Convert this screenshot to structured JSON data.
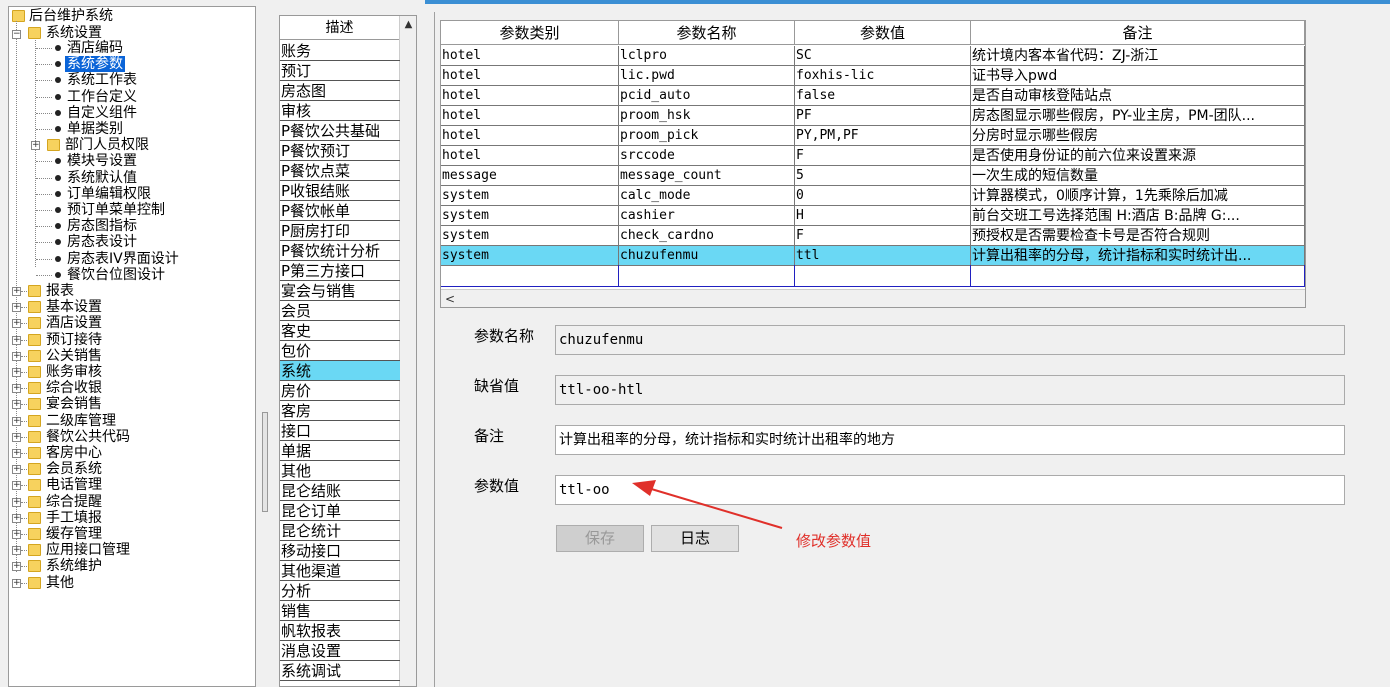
{
  "tree": {
    "root": "后台维护系统",
    "system_settings": "系统设置",
    "children": [
      "酒店编码",
      "系统参数",
      "系统工作表",
      "工作台定义",
      "自定义组件",
      "单据类别",
      "部门人员权限",
      "模块号设置",
      "系统默认值",
      "订单编辑权限",
      "预订单菜单控制",
      "房态图指标",
      "房态表设计",
      "房态表IV界面设计",
      "餐饮台位图设计"
    ],
    "selected": "系统参数",
    "groups": [
      "报表",
      "基本设置",
      "酒店设置",
      "预订接待",
      "公关销售",
      "账务审核",
      "综合收银",
      "宴会销售",
      "二级库管理",
      "餐饮公共代码",
      "客房中心",
      "会员系统",
      "电话管理",
      "综合提醒",
      "手工填报",
      "缓存管理",
      "应用接口管理",
      "系统维护",
      "其他"
    ]
  },
  "categories": {
    "header": "描述",
    "items": [
      "账务",
      "预订",
      "房态图",
      "审核",
      "P餐饮公共基础",
      "P餐饮预订",
      "P餐饮点菜",
      "P收银结账",
      "P餐饮帐单",
      "P厨房打印",
      "P餐饮统计分析",
      "P第三方接口",
      "宴会与销售",
      "会员",
      "客史",
      "包价",
      "系统",
      "房价",
      "客房",
      "接口",
      "单据",
      "其他",
      "昆仑结账",
      "昆仑订单",
      "昆仑统计",
      "移动接口",
      "其他渠道",
      "分析",
      "销售",
      "帆软报表",
      "消息设置",
      "系统调试"
    ],
    "selected": "系统"
  },
  "grid": {
    "columns": [
      "参数类别",
      "参数名称",
      "参数值",
      "备注"
    ],
    "rows": [
      [
        "hotel",
        "lclpro",
        "SC",
        "统计境内客本省代码：ZJ-浙江"
      ],
      [
        "hotel",
        "lic.pwd",
        "foxhis-lic",
        "证书导入pwd"
      ],
      [
        "hotel",
        "pcid_auto",
        "false",
        "是否自动审核登陆站点"
      ],
      [
        "hotel",
        "proom_hsk",
        "PF",
        "房态图显示哪些假房，PY-业主房，PM-团队..."
      ],
      [
        "hotel",
        "proom_pick",
        "PY,PM,PF",
        "分房时显示哪些假房"
      ],
      [
        "hotel",
        "srccode",
        "F",
        "是否使用身份证的前六位来设置来源"
      ],
      [
        "message",
        "message_count",
        "5",
        "一次生成的短信数量"
      ],
      [
        "system",
        "calc_mode",
        "0",
        "计算器模式，0顺序计算，1先乘除后加减"
      ],
      [
        "system",
        "cashier",
        "H",
        "前台交班工号选择范围 H:酒店  B:品牌 G:..."
      ],
      [
        "system",
        "check_cardno",
        "F",
        "预授权是否需要检查卡号是否符合规则"
      ],
      [
        "system",
        "chuzufenmu",
        "ttl",
        "计算出租率的分母，统计指标和实时统计出..."
      ]
    ],
    "active_row": 10,
    "scroll_left": "<"
  },
  "form": {
    "name_label": "参数名称",
    "name_value": "chuzufenmu",
    "default_label": "缺省值",
    "default_value": "ttl-oo-htl",
    "remark_label": "备注",
    "remark_value": "计算出租率的分母，统计指标和实时统计出租率的地方",
    "value_label": "参数值",
    "value_value": "ttl-oo",
    "save_button": "保存",
    "log_button": "日志",
    "annotation": "修改参数值"
  },
  "colors": {
    "selection_blue": "#0a64d8",
    "active_row": "#6ad8f4",
    "annotation_red": "#e0302a"
  }
}
